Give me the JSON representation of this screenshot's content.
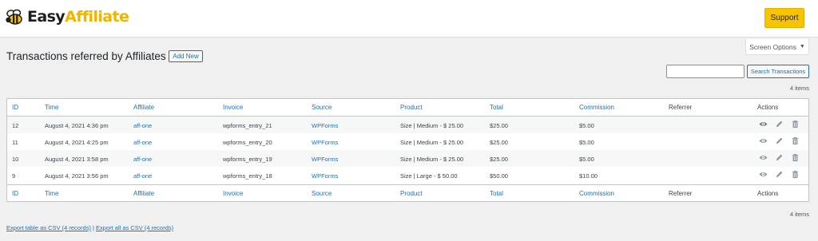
{
  "brand": {
    "name_part1": "Easy",
    "name_part2": "Affiliate",
    "accent": "#f8c300"
  },
  "header": {
    "support_label": "Support"
  },
  "screen_options": {
    "label": "Screen Options",
    "caret": "▼"
  },
  "page": {
    "title": "Transactions referred by Affiliates",
    "add_new_label": "Add New"
  },
  "search": {
    "value": "",
    "placeholder": "",
    "button_label": "Search Transactions"
  },
  "items_count": "4 items",
  "table": {
    "columns": [
      "ID",
      "Time",
      "Affiliate",
      "Invoice",
      "Source",
      "Product",
      "Total",
      "Commission",
      "Referrer",
      "Actions"
    ],
    "rows": [
      {
        "id": "12",
        "time": "August 4, 2021 4:36 pm",
        "affiliate": "aff-one",
        "invoice": "wpforms_entry_21",
        "source": "WPForms",
        "product": "Size | Medium - $ 25.00",
        "total": "$25.00",
        "commission": "$5.00",
        "referrer": ""
      },
      {
        "id": "11",
        "time": "August 4, 2021 4:25 pm",
        "affiliate": "aff-one",
        "invoice": "wpforms_entry_20",
        "source": "WPForms",
        "product": "Size | Medium - $ 25.00",
        "total": "$25.00",
        "commission": "$5.00",
        "referrer": ""
      },
      {
        "id": "10",
        "time": "August 4, 2021 3:58 pm",
        "affiliate": "aff-one",
        "invoice": "wpforms_entry_19",
        "source": "WPForms",
        "product": "Size | Medium - $ 25.00",
        "total": "$25.00",
        "commission": "$5.00",
        "referrer": ""
      },
      {
        "id": "9",
        "time": "August 4, 2021 3:56 pm",
        "affiliate": "aff-one",
        "invoice": "wpforms_entry_18",
        "source": "WPForms",
        "product": "Size | Large - $ 50.00",
        "total": "$50.00",
        "commission": "$10.00",
        "referrer": ""
      }
    ],
    "action_icons": [
      "eye-icon",
      "pencil-icon",
      "trash-icon"
    ]
  },
  "exports": {
    "table_csv": "Export table as CSV (4 records)",
    "separator": " | ",
    "all_csv": "Export all as CSV (4 records)"
  }
}
